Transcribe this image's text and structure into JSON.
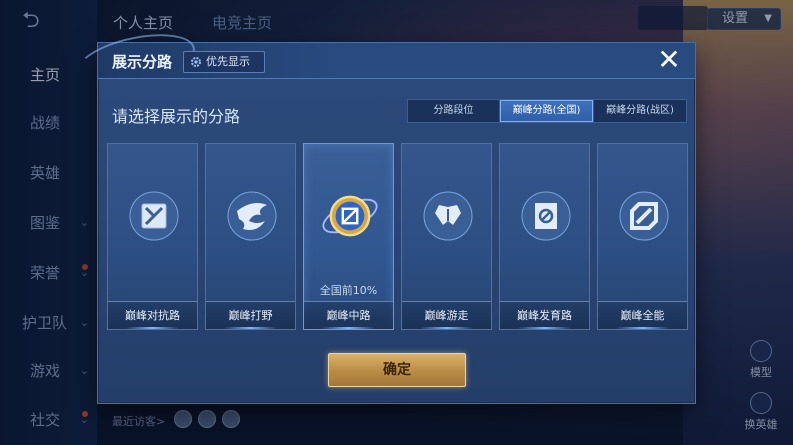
{
  "app": {
    "top_tabs": [
      "个人主页",
      "电竞主页"
    ],
    "settings_label": "设置",
    "bottom_visitors_label": "最近访客>"
  },
  "nav": {
    "items": [
      {
        "label": "主页",
        "active": true,
        "chevron": false,
        "dot": false
      },
      {
        "label": "战绩",
        "active": false,
        "chevron": false,
        "dot": false
      },
      {
        "label": "英雄",
        "active": false,
        "chevron": false,
        "dot": false
      },
      {
        "label": "图鉴",
        "active": false,
        "chevron": true,
        "dot": false
      },
      {
        "label": "荣誉",
        "active": false,
        "chevron": true,
        "dot": true
      },
      {
        "label": "护卫队",
        "active": false,
        "chevron": true,
        "dot": false
      },
      {
        "label": "游戏",
        "active": false,
        "chevron": true,
        "dot": false
      },
      {
        "label": "社交",
        "active": false,
        "chevron": true,
        "dot": true
      }
    ]
  },
  "side": {
    "model_label": "模型",
    "switch_hero_label": "换英雄"
  },
  "modal": {
    "title": "展示分路",
    "priority_label": "优先显示",
    "close_label": "✕",
    "subtitle": "请选择展示的分路",
    "tabs": [
      {
        "label": "分路段位",
        "active": false
      },
      {
        "label": "巅峰分路(全国)",
        "active": true
      },
      {
        "label": "巅峰分路(战区)",
        "active": false
      }
    ],
    "lanes": [
      {
        "label": "巅峰对抗路",
        "rank": "",
        "icon": "clash-lane-icon",
        "selected": false
      },
      {
        "label": "巅峰打野",
        "rank": "",
        "icon": "jungle-icon",
        "selected": false
      },
      {
        "label": "巅峰中路",
        "rank": "全国前10%",
        "icon": "mid-lane-icon",
        "selected": true
      },
      {
        "label": "巅峰游走",
        "rank": "",
        "icon": "roam-icon",
        "selected": false
      },
      {
        "label": "巅峰发育路",
        "rank": "",
        "icon": "farm-lane-icon",
        "selected": false
      },
      {
        "label": "巅峰全能",
        "rank": "",
        "icon": "all-round-icon",
        "selected": false
      }
    ],
    "confirm_label": "确定"
  },
  "colors": {
    "modal_bg": "#2a4675",
    "accent_blue": "#3f71bf",
    "confirm_gold": "#b98c44"
  }
}
